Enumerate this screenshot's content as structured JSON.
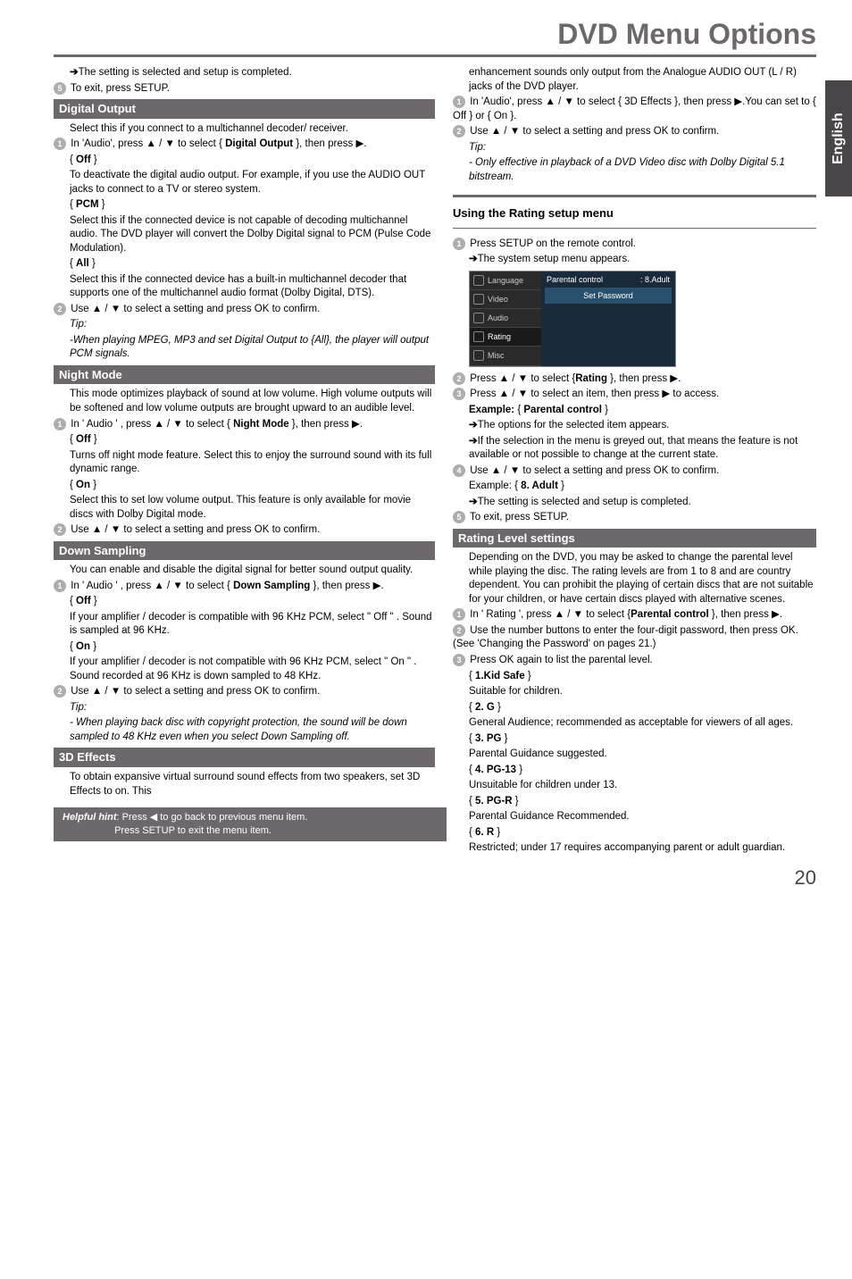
{
  "header": {
    "title": "DVD Menu Options"
  },
  "sideTab": "English",
  "pageNumber": "20",
  "left": {
    "pre1": "The setting is selected and setup is completed.",
    "pre2": "To exit, press SETUP.",
    "digitalOutput": {
      "title": "Digital Output",
      "intro": "Select this if you connect to a multichannel decoder/ receiver.",
      "step1a": "In 'Audio', press ▲ / ▼ to select { ",
      "step1b": "Digital Output",
      "step1c": " }, then press ▶.",
      "off": "Off",
      "offText": "To deactivate the digital audio output. For example, if you use the AUDIO OUT jacks to connect to a TV or stereo system.",
      "pcm": "PCM",
      "pcmText": "Select this if the connected device is not capable of decoding multichannel audio. The DVD player will convert the Dolby Digital signal to PCM (Pulse Code Modulation).",
      "all": "All",
      "allText": "Select this if the connected device has a built-in multichannel decoder that supports one of the multichannel audio format (Dolby Digital, DTS).",
      "step2": "Use ▲ / ▼ to select a setting  and press OK to confirm.",
      "tip": "Tip:",
      "tipText": "-When playing MPEG, MP3 and set Digital Output to {All}, the player will output PCM signals."
    },
    "nightMode": {
      "title": "Night Mode",
      "intro": "This mode optimizes playback of sound at low volume. High volume outputs will be softened and low volume outputs are brought upward to an audible level.",
      "step1a": "In ' Audio ' , press ▲ / ▼ to select { ",
      "step1b": "Night Mode",
      "step1c": " }, then press ▶.",
      "off": "Off",
      "offText": "Turns off night mode feature. Select this to enjoy the surround sound with its full dynamic range.",
      "on": "On",
      "onText": "Select this to set low volume output. This feature is only available for movie discs with Dolby Digital mode.",
      "step2": "Use ▲ / ▼ to select a setting and press OK to confirm."
    },
    "downSampling": {
      "title": "Down Sampling",
      "intro": "You can enable and disable the digital signal for better sound output quality.",
      "step1a": "In ' Audio ' , press ▲ / ▼ to select { ",
      "step1b": "Down Sampling",
      "step1c": " }, then press ▶.",
      "off": "Off",
      "offText": "If your amplifier / decoder is compatible with 96 KHz PCM, select \" Off \" . Sound is sampled at 96 KHz.",
      "on": "On",
      "onText": "If your amplifier / decoder is not compatible with 96 KHz PCM, select \" On \" . Sound recorded at 96 KHz is down sampled to 48 KHz.",
      "step2": "Use ▲ / ▼ to select a setting and press OK to confirm.",
      "tip": "Tip:",
      "tipText": "- When playing back disc with copyright protection, the sound will be down sampled to 48 KHz even when you select Down Sampling off."
    },
    "threeD": {
      "title": "3D Effects",
      "text": "To obtain expansive virtual surround sound effects from two speakers, set 3D Effects to on. This"
    }
  },
  "right": {
    "cont1": "enhancement sounds only output from the Analogue AUDIO OUT (L / R) jacks of the DVD player.",
    "step1": "In 'Audio', press ▲ / ▼ to select { 3D Effects }, then press ▶.You can set to { Off } or { On }.",
    "step2": "Use ▲ / ▼ to select a setting and press OK to confirm.",
    "tip": "Tip:",
    "tipText": "- Only effective in playback of a DVD Video disc with Dolby Digital 5.1 bitstream.",
    "ratingMenuTitle": "Using the Rating setup menu",
    "rStep1a": "Press SETUP on the remote control.",
    "rStep1b": "The system setup menu appears.",
    "menu": {
      "language": "Language",
      "video": "Video",
      "audio": "Audio",
      "rating": "Rating",
      "misc": "Misc",
      "parental": "Parental  control",
      "adult": ": 8.Adult",
      "setpw": "Set Password"
    },
    "rStep2": "Press ▲ / ▼ to select {",
    "rStep2b": "Rating",
    "rStep2c": " }, then press ▶.",
    "rStep3": "Press ▲ / ▼ to select an item, then press ▶ to access.",
    "exLabel": "Example:",
    "exValue": "Parental control",
    "ex1": "The options for the selected item appears.",
    "ex2": "If the selection in the menu is greyed out, that means the feature is not available or not possible to change at the current state.",
    "rStep4": "Use ▲ / ▼ to select a setting and press OK to confirm.",
    "ex3a": "Example: { ",
    "ex3b": "8. Adult",
    "ex3c": " }",
    "ex4": "The setting is selected and setup is completed.",
    "rStep5": "To exit, press SETUP.",
    "ratingLevel": {
      "title": "Rating Level settings",
      "intro": "Depending on the DVD, you may be asked to change the parental level while playing the disc. The rating levels are from 1 to 8 and are country dependent. You can prohibit the playing of certain discs that are not suitable for your children, or have certain discs played with alternative scenes.",
      "s1a": "In ' Rating ', press ▲ / ▼ to select {",
      "s1b": "Parental control",
      "s1c": " }, then press ▶.",
      "s2": "Use the number buttons to enter the four-digit password, then press OK.(See 'Changing the Password' on pages 21.)",
      "s3": "Press OK again to list the parental level.",
      "kid": "1.Kid Safe",
      "kidText": "Suitable for children.",
      "g": "2. G",
      "gText": "General Audience; recommended as acceptable for viewers of all ages.",
      "pg": "3. PG",
      "pgText": "Parental Guidance suggested.",
      "pg13": "4. PG-13",
      "pg13Text": "Unsuitable for children under 13.",
      "pgr": "5. PG-R",
      "pgrText": "Parental Guidance Recommended.",
      "r": "6. R",
      "rText": "Restricted; under 17 requires accompanying parent or adult guardian."
    }
  },
  "hint": {
    "label": "Helpful hint",
    "line1": ":  Press ◀ to go back to previous menu item.",
    "line2": "Press SETUP to exit the menu item."
  }
}
